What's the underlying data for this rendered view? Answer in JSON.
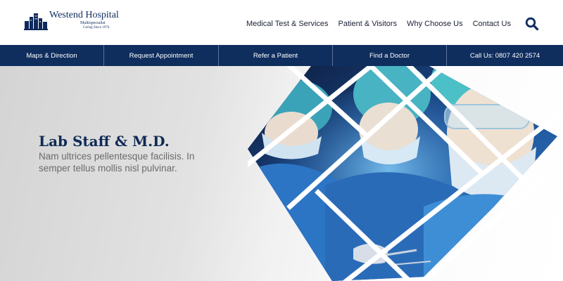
{
  "brand": {
    "name": "Westend Hospital",
    "subtitle": "Multispecialist",
    "tagline": "Caring Since 1976"
  },
  "nav": {
    "items": [
      "Medical Test & Services",
      "Patient & Visitors",
      "Why Choose Us",
      "Contact Us"
    ],
    "search_icon": "search-icon"
  },
  "quickbar": {
    "items": [
      "Maps & Direction",
      "Request Appointment",
      "Refer a Patient",
      "Find a Doctor",
      "Call Us: 0807 420 2574"
    ]
  },
  "hero": {
    "title": "Lab Staff & M.D.",
    "text": "Nam ultrices pellentesque facilisis. In semper tellus mollis nisl pulvinar."
  },
  "colors": {
    "brand": "#0f2e5e",
    "surgical_blue": "#2f7fcf",
    "cap_teal": "#4aa9b8"
  }
}
